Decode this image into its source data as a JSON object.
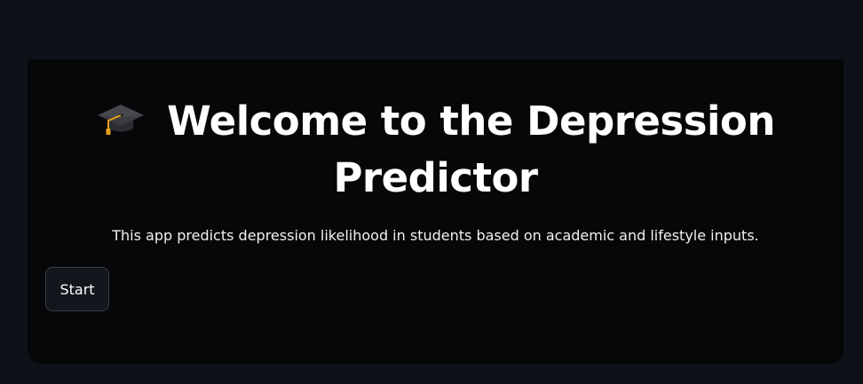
{
  "main": {
    "title_line1": "Welcome to the Depression",
    "title_line2": "Predictor",
    "title_icon": "graduation-cap-icon",
    "description": "This app predicts depression likelihood in students based on academic and lifestyle inputs.",
    "start_label": "Start"
  },
  "colors": {
    "background": "#0e1117",
    "card": "#060708",
    "text": "#ffffff",
    "button_bg": "#13161c",
    "button_border": "#3a3e46",
    "icon_tassel": "#e6a11a"
  }
}
